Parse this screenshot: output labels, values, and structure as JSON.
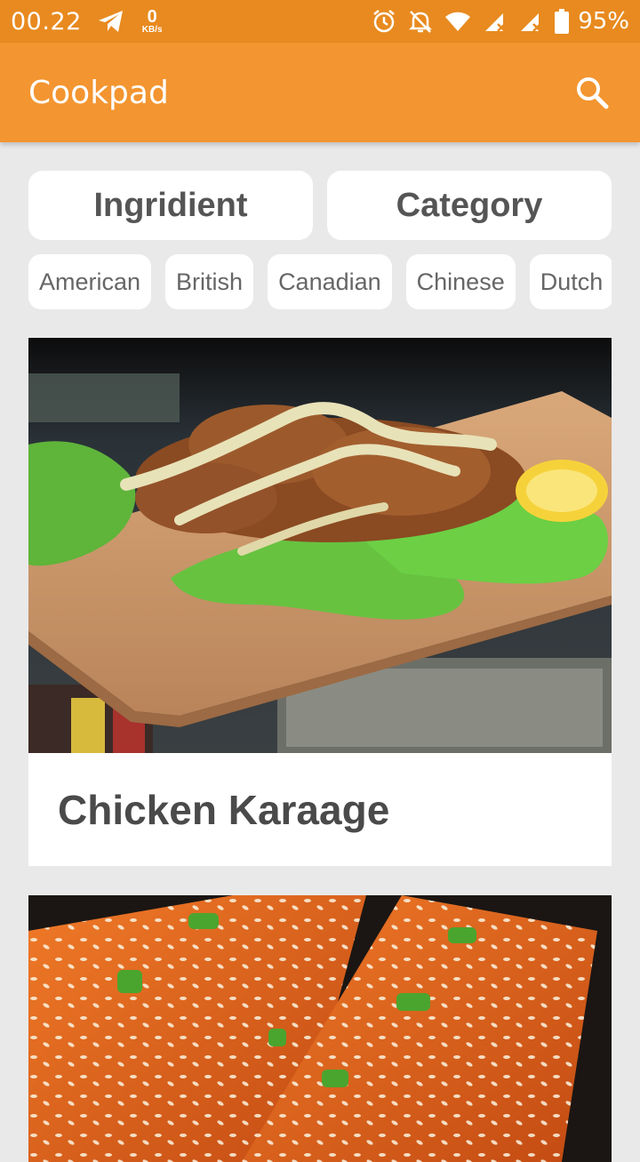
{
  "status_bar": {
    "time": "00.22",
    "net_speed_value": "0",
    "net_speed_unit": "KB/s",
    "battery": "95%"
  },
  "app_bar": {
    "title": "Cookpad",
    "search_icon": "search-icon"
  },
  "toggles": [
    {
      "label": "Ingridient"
    },
    {
      "label": "Category"
    }
  ],
  "areas": [
    {
      "label": "American"
    },
    {
      "label": "British"
    },
    {
      "label": "Canadian"
    },
    {
      "label": "Chinese"
    },
    {
      "label": "Dutch"
    }
  ],
  "recipes": [
    {
      "title": "Chicken Karaage",
      "image": "chicken-karaage-photo"
    },
    {
      "title": "",
      "image": "glazed-salmon-photo"
    }
  ],
  "colors": {
    "status_bar": "#e88a1f",
    "app_bar": "#f39530",
    "background": "#e9e9e9"
  }
}
